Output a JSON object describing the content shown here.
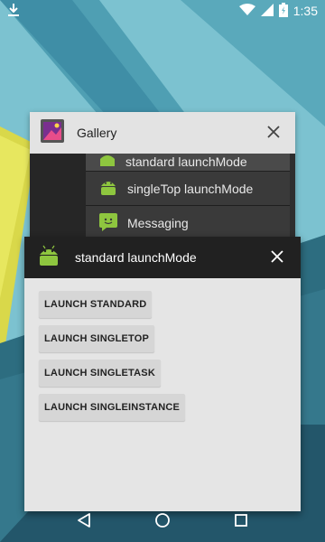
{
  "status_bar": {
    "time": "1:35",
    "icons": [
      "download-icon",
      "wifi-icon",
      "signal-icon",
      "battery-icon"
    ]
  },
  "recents": {
    "gallery_card": {
      "title": "Gallery",
      "app_icon": "gallery-icon",
      "close_icon": "close-icon",
      "rows": [
        {
          "label": "standard launchMode",
          "icon": "android-icon"
        },
        {
          "label": "singleTop launchMode",
          "icon": "android-icon"
        },
        {
          "label": "Messaging",
          "icon": "messaging-icon"
        }
      ]
    },
    "main_card": {
      "title": "standard launchMode",
      "app_icon": "android-icon",
      "close_icon": "close-icon",
      "buttons": [
        "LAUNCH STANDARD",
        "LAUNCH SINGLETOP",
        "LAUNCH SINGLETASK",
        "LAUNCH SINGLEINSTANCE"
      ]
    }
  },
  "nav_bar": {
    "back": "back-icon",
    "home": "home-icon",
    "recents": "recents-icon"
  },
  "colors": {
    "wallpaper_base": "#6fb9c9",
    "android_green": "#8ec63f",
    "main_header": "#212121",
    "gallery_header": "#e3e3e3"
  }
}
